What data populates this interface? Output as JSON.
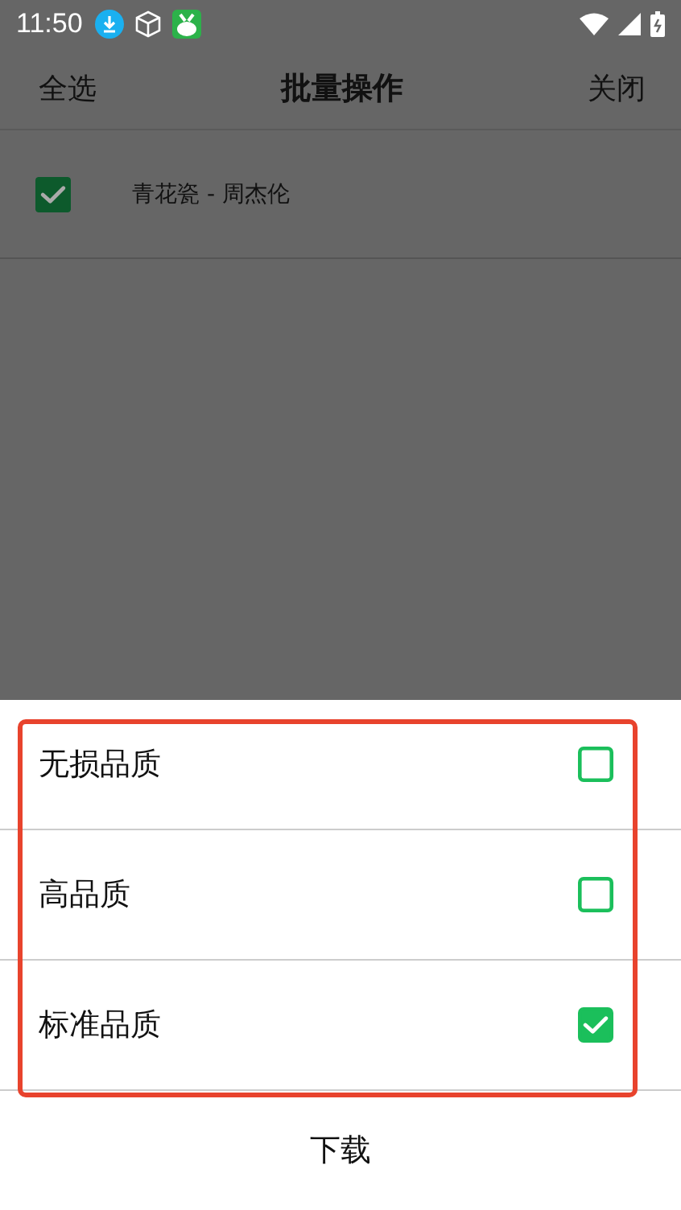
{
  "status_bar": {
    "time": "11:50"
  },
  "header": {
    "left_action": "全选",
    "title": "批量操作",
    "right_action": "关闭"
  },
  "songs": [
    {
      "title": "青花瓷 - 周杰伦",
      "checked": true
    }
  ],
  "quality_sheet": {
    "options": [
      {
        "label": "无损品质",
        "checked": false
      },
      {
        "label": "高品质",
        "checked": false
      },
      {
        "label": "标准品质",
        "checked": true
      }
    ],
    "action": "下载"
  }
}
